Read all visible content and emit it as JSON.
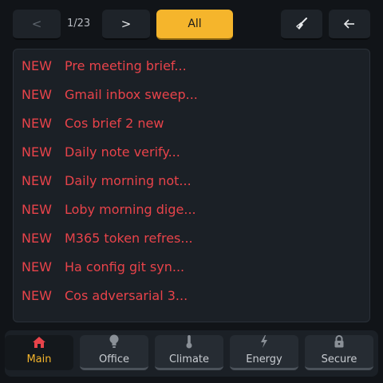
{
  "toolbar": {
    "prev_label": "<",
    "counter": "1/23",
    "next_label": ">",
    "all_label": "All"
  },
  "items": [
    {
      "tag": "NEW",
      "title": "Pre meeting brief..."
    },
    {
      "tag": "NEW",
      "title": "Gmail inbox sweep..."
    },
    {
      "tag": "NEW",
      "title": "Cos brief 2 new"
    },
    {
      "tag": "NEW",
      "title": "Daily note verify..."
    },
    {
      "tag": "NEW",
      "title": "Daily morning not..."
    },
    {
      "tag": "NEW",
      "title": "Loby morning dige..."
    },
    {
      "tag": "NEW",
      "title": "M365 token refres..."
    },
    {
      "tag": "NEW",
      "title": "Ha config git syn..."
    },
    {
      "tag": "NEW",
      "title": "Cos adversarial 3..."
    }
  ],
  "nav": [
    {
      "label": "Main",
      "icon": "home-icon",
      "active": true
    },
    {
      "label": "Office",
      "icon": "lightbulb-icon",
      "active": false
    },
    {
      "label": "Climate",
      "icon": "thermometer-icon",
      "active": false
    },
    {
      "label": "Energy",
      "icon": "lightning-icon",
      "active": false
    },
    {
      "label": "Secure",
      "icon": "lock-icon",
      "active": false
    }
  ],
  "colors": {
    "accent": "#f5b52c",
    "new_item": "#e8434a",
    "home_icon": "#e8434a"
  }
}
